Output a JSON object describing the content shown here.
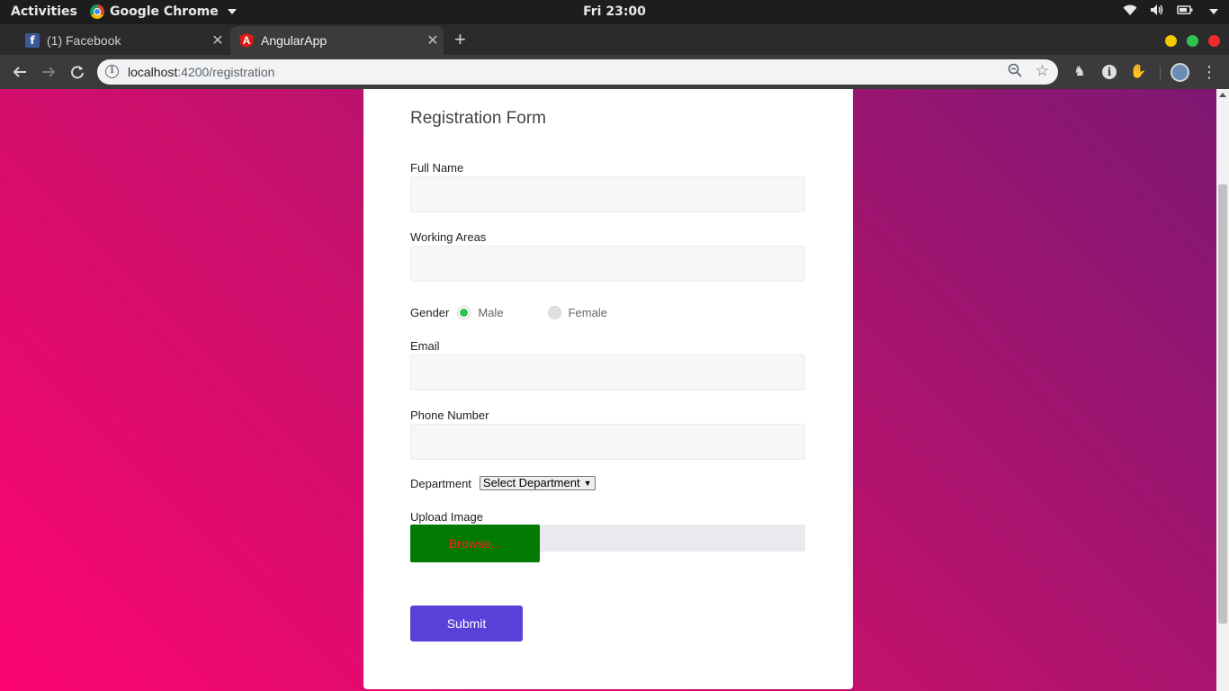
{
  "desktop": {
    "activities": "Activities",
    "app_menu": "Google Chrome",
    "clock": "Fri 23:00"
  },
  "browser": {
    "tabs": [
      {
        "title": "(1) Facebook",
        "favicon": "facebook-icon",
        "active": false
      },
      {
        "title": "AngularApp",
        "favicon": "angular-icon",
        "active": true
      }
    ],
    "url_host": "localhost",
    "url_path": ":4200/registration",
    "window_buttons": {
      "minimize_color": "#f5c800",
      "maximize_color": "#2ec14c",
      "close_color": "#f0292c"
    }
  },
  "form": {
    "title": "Registration Form",
    "full_name_label": "Full Name",
    "full_name_value": "",
    "working_areas_label": "Working Areas",
    "working_areas_value": "",
    "gender_label": "Gender",
    "gender_options": [
      {
        "label": "Male",
        "selected": true
      },
      {
        "label": "Female",
        "selected": false
      }
    ],
    "email_label": "Email",
    "email_value": "",
    "phone_label": "Phone Number",
    "phone_value": "",
    "department_label": "Department",
    "department_selected": "Select Department",
    "upload_label": "Upload Image",
    "browse_label": "Browse...",
    "submit_label": "Submit"
  },
  "colors": {
    "background_start": "#fc0570",
    "background_end": "#7d1873",
    "browse_bg": "#027a04",
    "browse_text": "#ff1e1e",
    "submit_bg": "#5b3fd9",
    "radio_checked": "#2ec14c"
  }
}
